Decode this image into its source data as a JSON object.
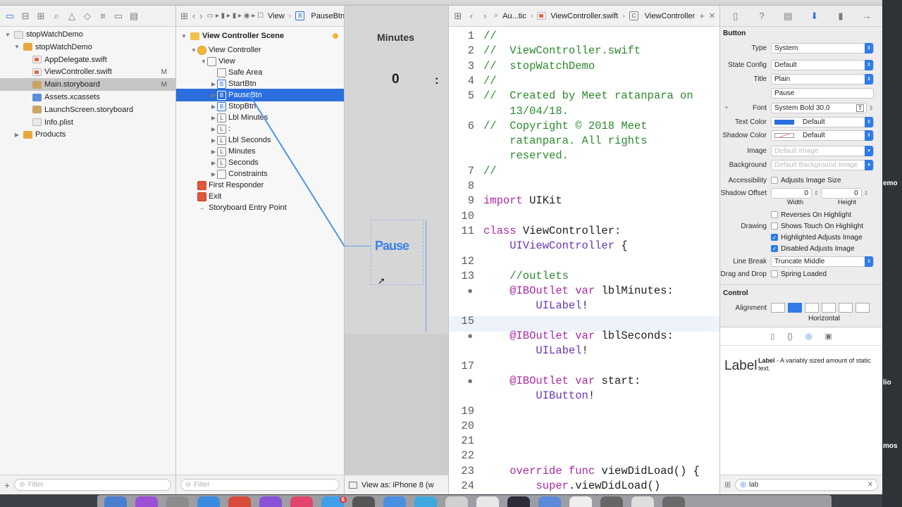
{
  "navigator": {
    "items": [
      {
        "label": "stopWatchDemo",
        "icon": "project-icon",
        "indent": 0,
        "flag": ""
      },
      {
        "label": "stopWatchDemo",
        "icon": "folder-icon",
        "indent": 1,
        "flag": ""
      },
      {
        "label": "AppDelegate.swift",
        "icon": "swift-file-icon",
        "indent": 2,
        "flag": ""
      },
      {
        "label": "ViewController.swift",
        "icon": "swift-file-icon",
        "indent": 2,
        "flag": "M"
      },
      {
        "label": "Main.storyboard",
        "icon": "storyboard-icon",
        "indent": 2,
        "flag": "M"
      },
      {
        "label": "Assets.xcassets",
        "icon": "assets-icon",
        "indent": 2,
        "flag": ""
      },
      {
        "label": "LaunchScreen.storyboard",
        "icon": "storyboard-icon",
        "indent": 2,
        "flag": ""
      },
      {
        "label": "Info.plist",
        "icon": "plist-icon",
        "indent": 2,
        "flag": ""
      },
      {
        "label": "Products",
        "icon": "folder-icon",
        "indent": 1,
        "flag": ""
      }
    ],
    "filter_placeholder": "Filter"
  },
  "outline": {
    "breadcrumb": [
      "View",
      "PauseBtn"
    ],
    "scene_title": "View Controller Scene",
    "rows": [
      {
        "label": "View Controller",
        "badge": "",
        "indent": 1
      },
      {
        "label": "View",
        "badge": "",
        "indent": 2
      },
      {
        "label": "Safe Area",
        "badge": "",
        "indent": 3
      },
      {
        "label": "StartBtn",
        "badge": "B",
        "indent": 3
      },
      {
        "label": "PauseBtn",
        "badge": "B",
        "indent": 3
      },
      {
        "label": "StopBtn",
        "badge": "B",
        "indent": 3
      },
      {
        "label": "Lbl Minutes",
        "badge": "L",
        "indent": 3
      },
      {
        "label": ":",
        "badge": "L",
        "indent": 3
      },
      {
        "label": "Lbl Seconds",
        "badge": "L",
        "indent": 3
      },
      {
        "label": "Minutes",
        "badge": "L",
        "indent": 3
      },
      {
        "label": "Seconds",
        "badge": "L",
        "indent": 3
      },
      {
        "label": "Constraints",
        "badge": "",
        "indent": 3
      },
      {
        "label": "First Responder",
        "badge": "",
        "indent": 1
      },
      {
        "label": "Exit",
        "badge": "",
        "indent": 1
      },
      {
        "label": "Storyboard Entry Point",
        "badge": "",
        "indent": 1
      }
    ],
    "filter_placeholder": "Filter"
  },
  "canvas": {
    "label_minutes": "Minutes",
    "label_zero": "0",
    "label_colon": ":",
    "button_text": "Pause",
    "view_as": "View as: iPhone 8 (w"
  },
  "editor": {
    "breadcrumb": [
      "Au...tic",
      "ViewController.swift",
      "ViewController"
    ],
    "lines": [
      {
        "n": "1",
        "parts": [
          [
            "cm",
            "//"
          ]
        ]
      },
      {
        "n": "2",
        "parts": [
          [
            "cm",
            "//  ViewController.swift"
          ]
        ]
      },
      {
        "n": "3",
        "parts": [
          [
            "cm",
            "//  stopWatchDemo"
          ]
        ]
      },
      {
        "n": "4",
        "parts": [
          [
            "cm",
            "//"
          ]
        ]
      },
      {
        "n": "5",
        "parts": [
          [
            "cm",
            "//  Created by Meet ratanpara on"
          ]
        ]
      },
      {
        "n": "",
        "parts": [
          [
            "cm",
            "    13/04/18."
          ]
        ]
      },
      {
        "n": "6",
        "parts": [
          [
            "cm",
            "//  Copyright © 2018 Meet"
          ]
        ]
      },
      {
        "n": "",
        "parts": [
          [
            "cm",
            "    ratanpara. All rights"
          ]
        ]
      },
      {
        "n": "",
        "parts": [
          [
            "cm",
            "    reserved."
          ]
        ]
      },
      {
        "n": "7",
        "parts": [
          [
            "cm",
            "//"
          ]
        ]
      },
      {
        "n": "8",
        "parts": []
      },
      {
        "n": "9",
        "parts": [
          [
            "kw",
            "import"
          ],
          [
            "tx",
            " UIKit"
          ]
        ]
      },
      {
        "n": "10",
        "parts": []
      },
      {
        "n": "11",
        "parts": [
          [
            "kw",
            "class"
          ],
          [
            "tx",
            " ViewController:"
          ]
        ]
      },
      {
        "n": "",
        "parts": [
          [
            "ty",
            "    UIViewController"
          ],
          [
            "tx",
            " {"
          ]
        ]
      },
      {
        "n": "12",
        "parts": []
      },
      {
        "n": "13",
        "parts": [
          [
            "cm",
            "    //outlets"
          ]
        ]
      },
      {
        "n": "●",
        "parts": [
          [
            "kw",
            "    @IBOutlet var"
          ],
          [
            "tx",
            " lblMinutes:"
          ]
        ]
      },
      {
        "n": "",
        "parts": [
          [
            "ty",
            "        UILabel"
          ],
          [
            "tx",
            "!"
          ]
        ]
      },
      {
        "n": "15",
        "parts": []
      },
      {
        "n": "●",
        "parts": [
          [
            "kw",
            "    @IBOutlet var"
          ],
          [
            "tx",
            " lblSeconds:"
          ]
        ]
      },
      {
        "n": "",
        "parts": [
          [
            "ty",
            "        UILabel"
          ],
          [
            "tx",
            "!"
          ]
        ]
      },
      {
        "n": "17",
        "parts": []
      },
      {
        "n": "●",
        "parts": [
          [
            "kw",
            "    @IBOutlet var"
          ],
          [
            "tx",
            " start:"
          ]
        ]
      },
      {
        "n": "",
        "parts": [
          [
            "ty",
            "        UIButton"
          ],
          [
            "tx",
            "!"
          ]
        ]
      },
      {
        "n": "19",
        "parts": []
      },
      {
        "n": "20",
        "parts": []
      },
      {
        "n": "21",
        "parts": []
      },
      {
        "n": "22",
        "parts": []
      },
      {
        "n": "23",
        "parts": [
          [
            "kw",
            "    override func"
          ],
          [
            "tx",
            " viewDidLoad() {"
          ]
        ]
      },
      {
        "n": "24",
        "parts": [
          [
            "kw",
            "        super"
          ],
          [
            "tx",
            ".viewDidLoad()"
          ]
        ]
      }
    ]
  },
  "inspector": {
    "section_button": "Button",
    "type_label": "Type",
    "type_value": "System",
    "state_label": "State Config",
    "state_value": "Default",
    "title_label": "Title",
    "title_value": "Plain",
    "title_text": "Pause",
    "font_label": "Font",
    "font_value": "System Bold 30.0",
    "textcolor_label": "Text Color",
    "textcolor_value": "Default",
    "shadowcolor_label": "Shadow Color",
    "shadowcolor_value": "Default",
    "image_label": "Image",
    "image_value": "Default Image",
    "background_label": "Background",
    "background_value": "Default Background Image",
    "accessibility_label": "Accessibility",
    "accessibility_value": "Adjusts Image Size",
    "shadowoffset_label": "Shadow Offset",
    "width_value": "0",
    "height_value": "0",
    "width_label": "Width",
    "height_label": "Height",
    "reverses_label": "Reverses On Highlight",
    "drawing_label": "Drawing",
    "shows_touch_label": "Shows Touch On Highlight",
    "highlighted_label": "Highlighted Adjusts Image",
    "disabled_label": "Disabled Adjusts Image",
    "linebreak_label": "Line Break",
    "linebreak_value": "Truncate Middle",
    "dragdrop_label": "Drag and Drop",
    "spring_label": "Spring Loaded",
    "section_control": "Control",
    "alignment_label": "Alignment",
    "horizontal_label": "Horizontal",
    "library_title": "Label",
    "library_name": "Label",
    "library_desc": "A variably sized amount of static text.",
    "search_value": "lab"
  },
  "desktop": {
    "labels": [
      "emo",
      "lio",
      "mos"
    ],
    "dock_badge": "6"
  },
  "colors": {
    "accent": "#2a6fdd",
    "comment": "#2d8a2d",
    "keyword": "#ad2aa5"
  }
}
